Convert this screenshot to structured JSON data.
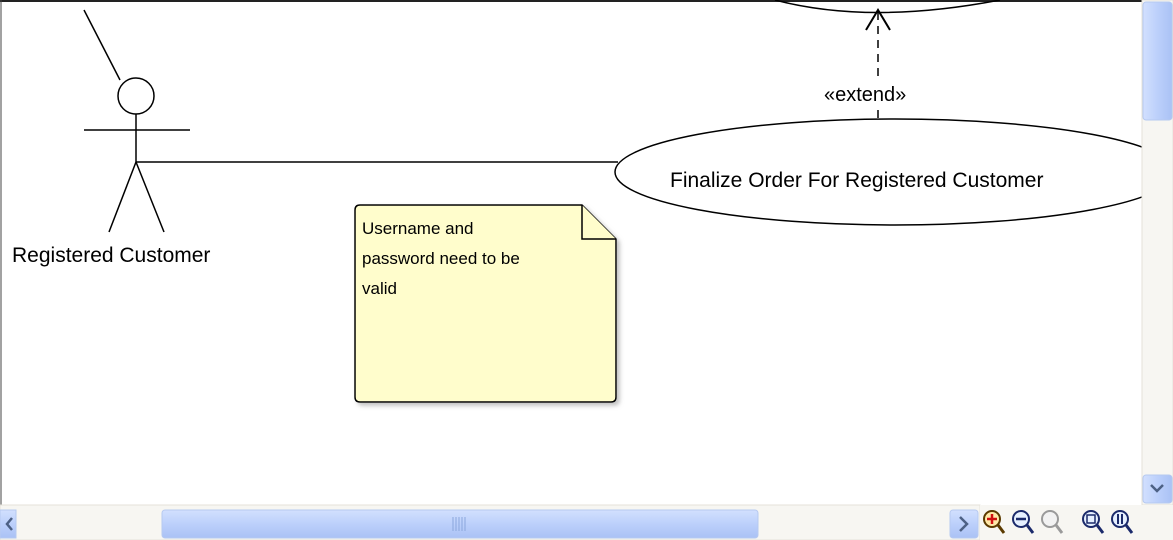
{
  "diagram": {
    "actor": {
      "label": "Registered Customer"
    },
    "use_case": {
      "label": "Finalize Order For Registered Customer"
    },
    "relationship": {
      "label": "«extend»"
    },
    "note": {
      "lines": [
        "Username and",
        "password need to be",
        "valid"
      ]
    }
  },
  "toolbar": {
    "icons": [
      "zoom-in-icon",
      "zoom-out-icon",
      "zoom-icon",
      "zoom-fit-icon",
      "zoom-100-icon"
    ]
  },
  "colors": {
    "note_fill": "#fffdcc",
    "scrollbar_track": "#f7f6f2",
    "scrollbar_thumb": "#c3d5fd",
    "scrollbar_border": "#b6c9f0"
  }
}
